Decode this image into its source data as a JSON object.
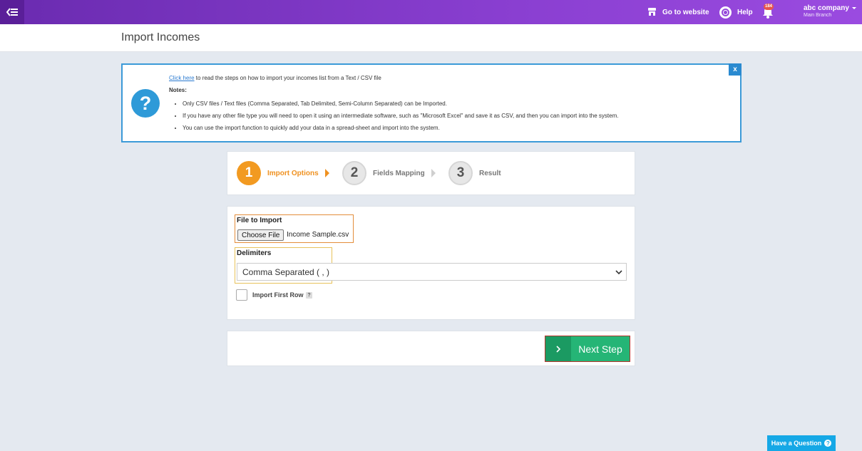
{
  "topbar": {
    "go_to_website": "Go to website",
    "help": "Help",
    "notification_count": "184",
    "company": "abc company",
    "branch": "Main Branch"
  },
  "page": {
    "title": "Import Incomes"
  },
  "info": {
    "link": "Click here",
    "intro": " to read the steps on how to import your incomes list from a Text / CSV file",
    "notes_label": "Notes:",
    "notes": [
      "Only CSV files / Text files (Comma Separated, Tab Delimited, Semi-Column Separated) can be Imported.",
      "If you have any other file type you will need to open it using an intermediate software, such as \"Microsoft Excel\" and save it as CSV, and then you can import into the system.",
      "You can use the import function to quickly add your data in a spread-sheet and import into the system."
    ],
    "close": "x",
    "help_glyph": "?"
  },
  "steps": [
    {
      "num": "1",
      "label": "Import Options"
    },
    {
      "num": "2",
      "label": "Fields Mapping"
    },
    {
      "num": "3",
      "label": "Result"
    }
  ],
  "form": {
    "file_label": "File to Import",
    "choose_button": "Choose File",
    "file_name": "Income Sample.csv",
    "delimiters_label": "Delimiters",
    "delimiter_selected": "Comma Separated ( , )",
    "import_first_row": "Import First Row",
    "tip": "?"
  },
  "actions": {
    "next": "Next Step"
  },
  "question": {
    "label": "Have a Question",
    "glyph": "?"
  }
}
